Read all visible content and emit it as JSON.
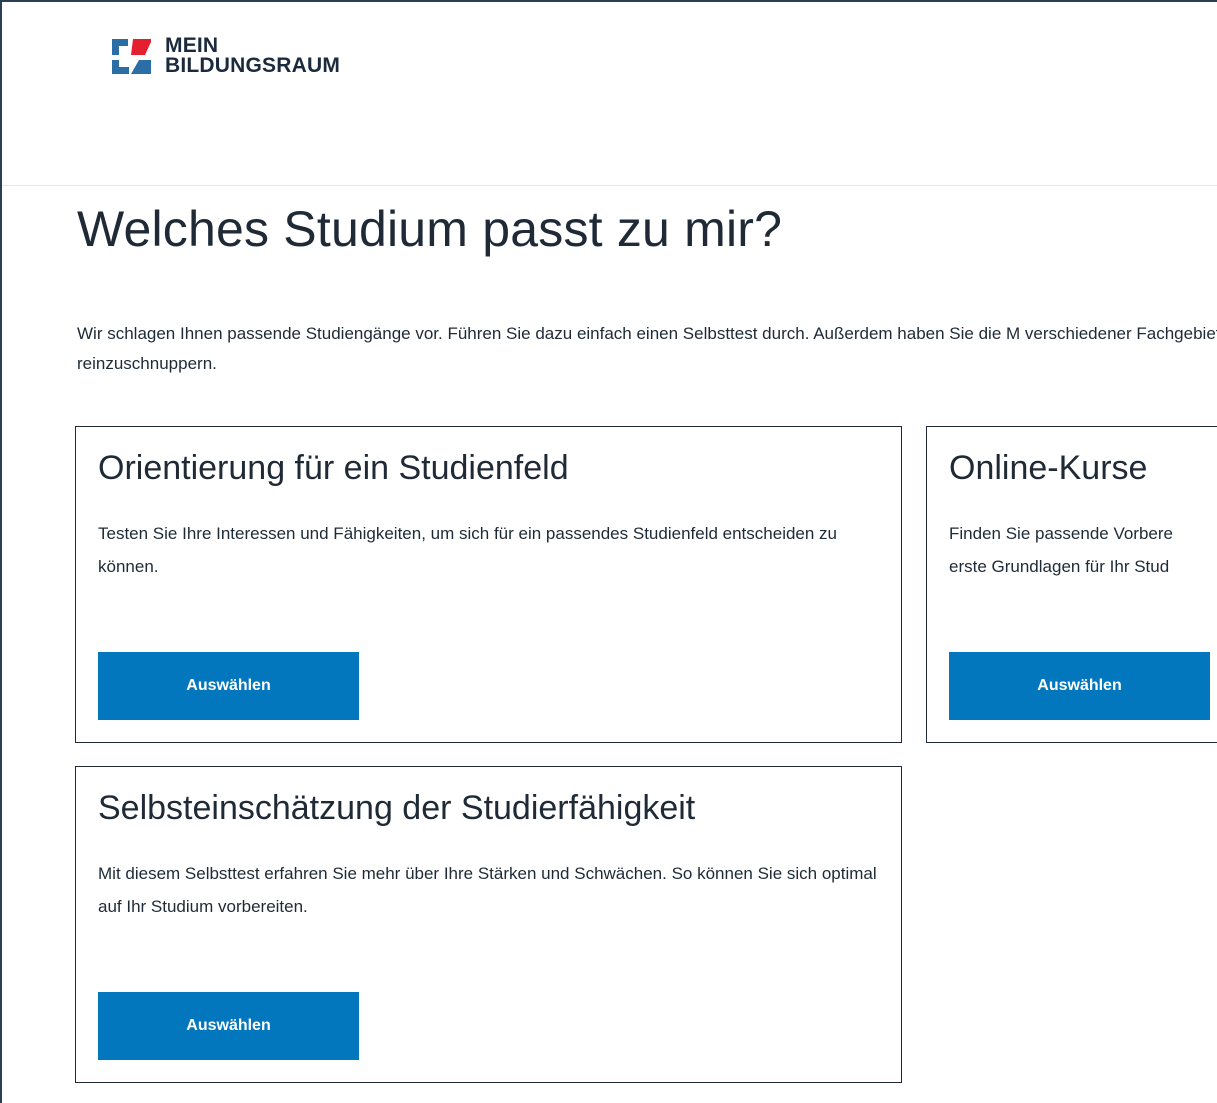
{
  "brand": {
    "logo_line1": "MEIN",
    "logo_line2": "BILDUNGSRAUM",
    "colors": {
      "primary_blue": "#0277bd",
      "logo_red": "#e4202e",
      "logo_blue": "#2b6ea6",
      "text_dark": "#1f2a36"
    }
  },
  "page": {
    "title": "Welches Studium passt zu mir?",
    "intro": "Wir schlagen Ihnen passende Studiengänge vor. Führen Sie dazu einfach einen Selbsttest durch. Außerdem haben Sie die M verschiedener Fachgebiete reinzuschnuppern."
  },
  "cards": [
    {
      "title": "Orientierung für ein Studienfeld",
      "description": "Testen Sie Ihre Interessen und Fähigkeiten, um sich für ein passendes Studienfeld entscheiden zu können.",
      "button_label": "Auswählen"
    },
    {
      "title": "Online-Kurse",
      "description_line1": "Finden Sie passende Vorbere",
      "description_line2": "erste Grundlagen für Ihr Stud",
      "button_label": "Auswählen"
    },
    {
      "title": "Selbsteinschätzung der Studierfähigkeit",
      "description": "Mit diesem Selbsttest erfahren Sie mehr über Ihre Stärken und Schwächen. So können Sie sich optimal auf Ihr Studium vorbereiten.",
      "button_label": "Auswählen"
    }
  ]
}
